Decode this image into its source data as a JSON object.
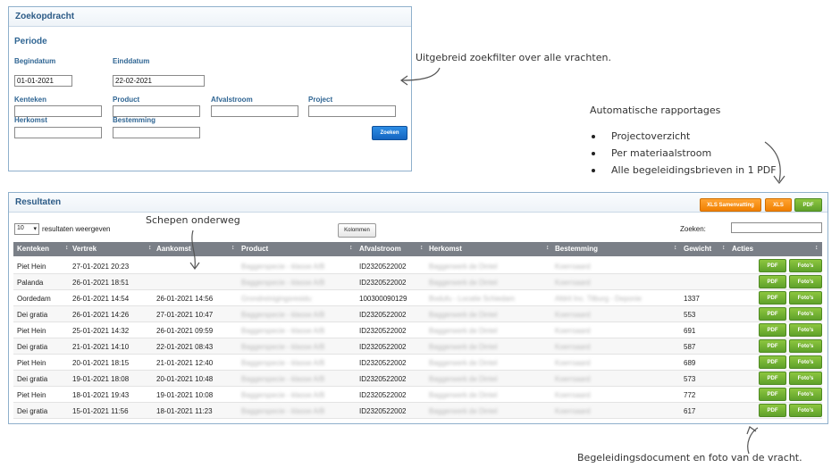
{
  "search": {
    "title": "Zoekopdracht",
    "period_label": "Periode",
    "begindatum_label": "Begindatum",
    "begindatum_value": "01-01-2021",
    "einddatum_label": "Einddatum",
    "einddatum_value": "22-02-2021",
    "kenteken_label": "Kenteken",
    "product_label": "Product",
    "afvalstroom_label": "Afvalstroom",
    "project_label": "Project",
    "herkomst_label": "Herkomst",
    "bestemming_label": "Bestemming",
    "search_button": "Zoeken"
  },
  "results": {
    "title": "Resultaten",
    "btn_xls_summary": "XLS Samenvatting",
    "btn_xls": "XLS",
    "btn_pdf": "PDF",
    "page_length": "10",
    "page_length_text": "resultaten weergeven",
    "columns_button": "Kolommen",
    "search_label": "Zoeken:",
    "headers": [
      "Kenteken",
      "Vertrek",
      "Aankomst",
      "Product",
      "Afvalstroom",
      "Herkomst",
      "Bestemming",
      "Gewicht",
      "Acties"
    ],
    "row_pdf": "PDF",
    "row_photos": "Foto's",
    "rows": [
      {
        "kenteken": "Piet Hein",
        "vertrek": "27-01-2021 20:23",
        "aankomst": "",
        "product": "Baggerspecie - klasse A/B",
        "afvalstroom": "ID2320522002",
        "herkomst": "Baggerwerk de Dintel",
        "bestemming": "Koerrsaard",
        "gewicht": ""
      },
      {
        "kenteken": "Palanda",
        "vertrek": "26-01-2021 18:51",
        "aankomst": "",
        "product": "Baggerspecie - klasse A/B",
        "afvalstroom": "ID2320522002",
        "herkomst": "Baggerwerk de Dintel",
        "bestemming": "Koerrsaard",
        "gewicht": ""
      },
      {
        "kenteken": "Oordedam",
        "vertrek": "26-01-2021 14:54",
        "aankomst": "26-01-2021 14:56",
        "product": "Grondreinigingsresidu",
        "afvalstroom": "100300090129",
        "herkomst": "Bodufu - Locatie Schiedam",
        "bestemming": "Afdrit Inc. Tilburg - Deponie",
        "gewicht": "1337"
      },
      {
        "kenteken": "Dei gratia",
        "vertrek": "26-01-2021 14:26",
        "aankomst": "27-01-2021 10:47",
        "product": "Baggerspecie - klasse A/B",
        "afvalstroom": "ID2320522002",
        "herkomst": "Baggerwerk de Dintel",
        "bestemming": "Koerrsaard",
        "gewicht": "553"
      },
      {
        "kenteken": "Piet Hein",
        "vertrek": "25-01-2021 14:32",
        "aankomst": "26-01-2021 09:59",
        "product": "Baggerspecie - klasse A/B",
        "afvalstroom": "ID2320522002",
        "herkomst": "Baggerwerk de Dintel",
        "bestemming": "Koerrsaard",
        "gewicht": "691"
      },
      {
        "kenteken": "Dei gratia",
        "vertrek": "21-01-2021 14:10",
        "aankomst": "22-01-2021 08:43",
        "product": "Baggerspecie - klasse A/B",
        "afvalstroom": "ID2320522002",
        "herkomst": "Baggerwerk de Dintel",
        "bestemming": "Koerrsaard",
        "gewicht": "587"
      },
      {
        "kenteken": "Piet Hein",
        "vertrek": "20-01-2021 18:15",
        "aankomst": "21-01-2021 12:40",
        "product": "Baggerspecie - klasse A/B",
        "afvalstroom": "ID2320522002",
        "herkomst": "Baggerwerk de Dintel",
        "bestemming": "Koerrsaard",
        "gewicht": "689"
      },
      {
        "kenteken": "Dei gratia",
        "vertrek": "19-01-2021 18:08",
        "aankomst": "20-01-2021 10:48",
        "product": "Baggerspecie - klasse A/B",
        "afvalstroom": "ID2320522002",
        "herkomst": "Baggerwerk de Dintel",
        "bestemming": "Koerrsaard",
        "gewicht": "573"
      },
      {
        "kenteken": "Piet Hein",
        "vertrek": "18-01-2021 19:43",
        "aankomst": "19-01-2021 10:08",
        "product": "Baggerspecie - klasse A/B",
        "afvalstroom": "ID2320522002",
        "herkomst": "Baggerwerk de Dintel",
        "bestemming": "Koerrsaard",
        "gewicht": "772"
      },
      {
        "kenteken": "Dei gratia",
        "vertrek": "15-01-2021 11:56",
        "aankomst": "18-01-2021 11:23",
        "product": "Baggerspecie - klasse A/B",
        "afvalstroom": "ID2320522002",
        "herkomst": "Baggerwerk de Dintel",
        "bestemming": "Koerrsaard",
        "gewicht": "617"
      }
    ]
  },
  "annotations": {
    "filter_note": "Uitgebreid zoekfilter over alle vrachten.",
    "reports_title": "Automatische rapportages",
    "reports_items": [
      "Projectoverzicht",
      "Per materiaalstroom",
      "Alle begeleidingsbrieven in 1 PDF"
    ],
    "ships_note": "Schepen onderweg",
    "docs_note": "Begeleidingsdocument en foto van de vracht."
  },
  "colors": {
    "header_blue": "#2b5a86",
    "button_blue": "#1e7ad6",
    "button_orange": "#f7901e",
    "button_green": "#72b234",
    "table_header": "#7a7f87"
  }
}
